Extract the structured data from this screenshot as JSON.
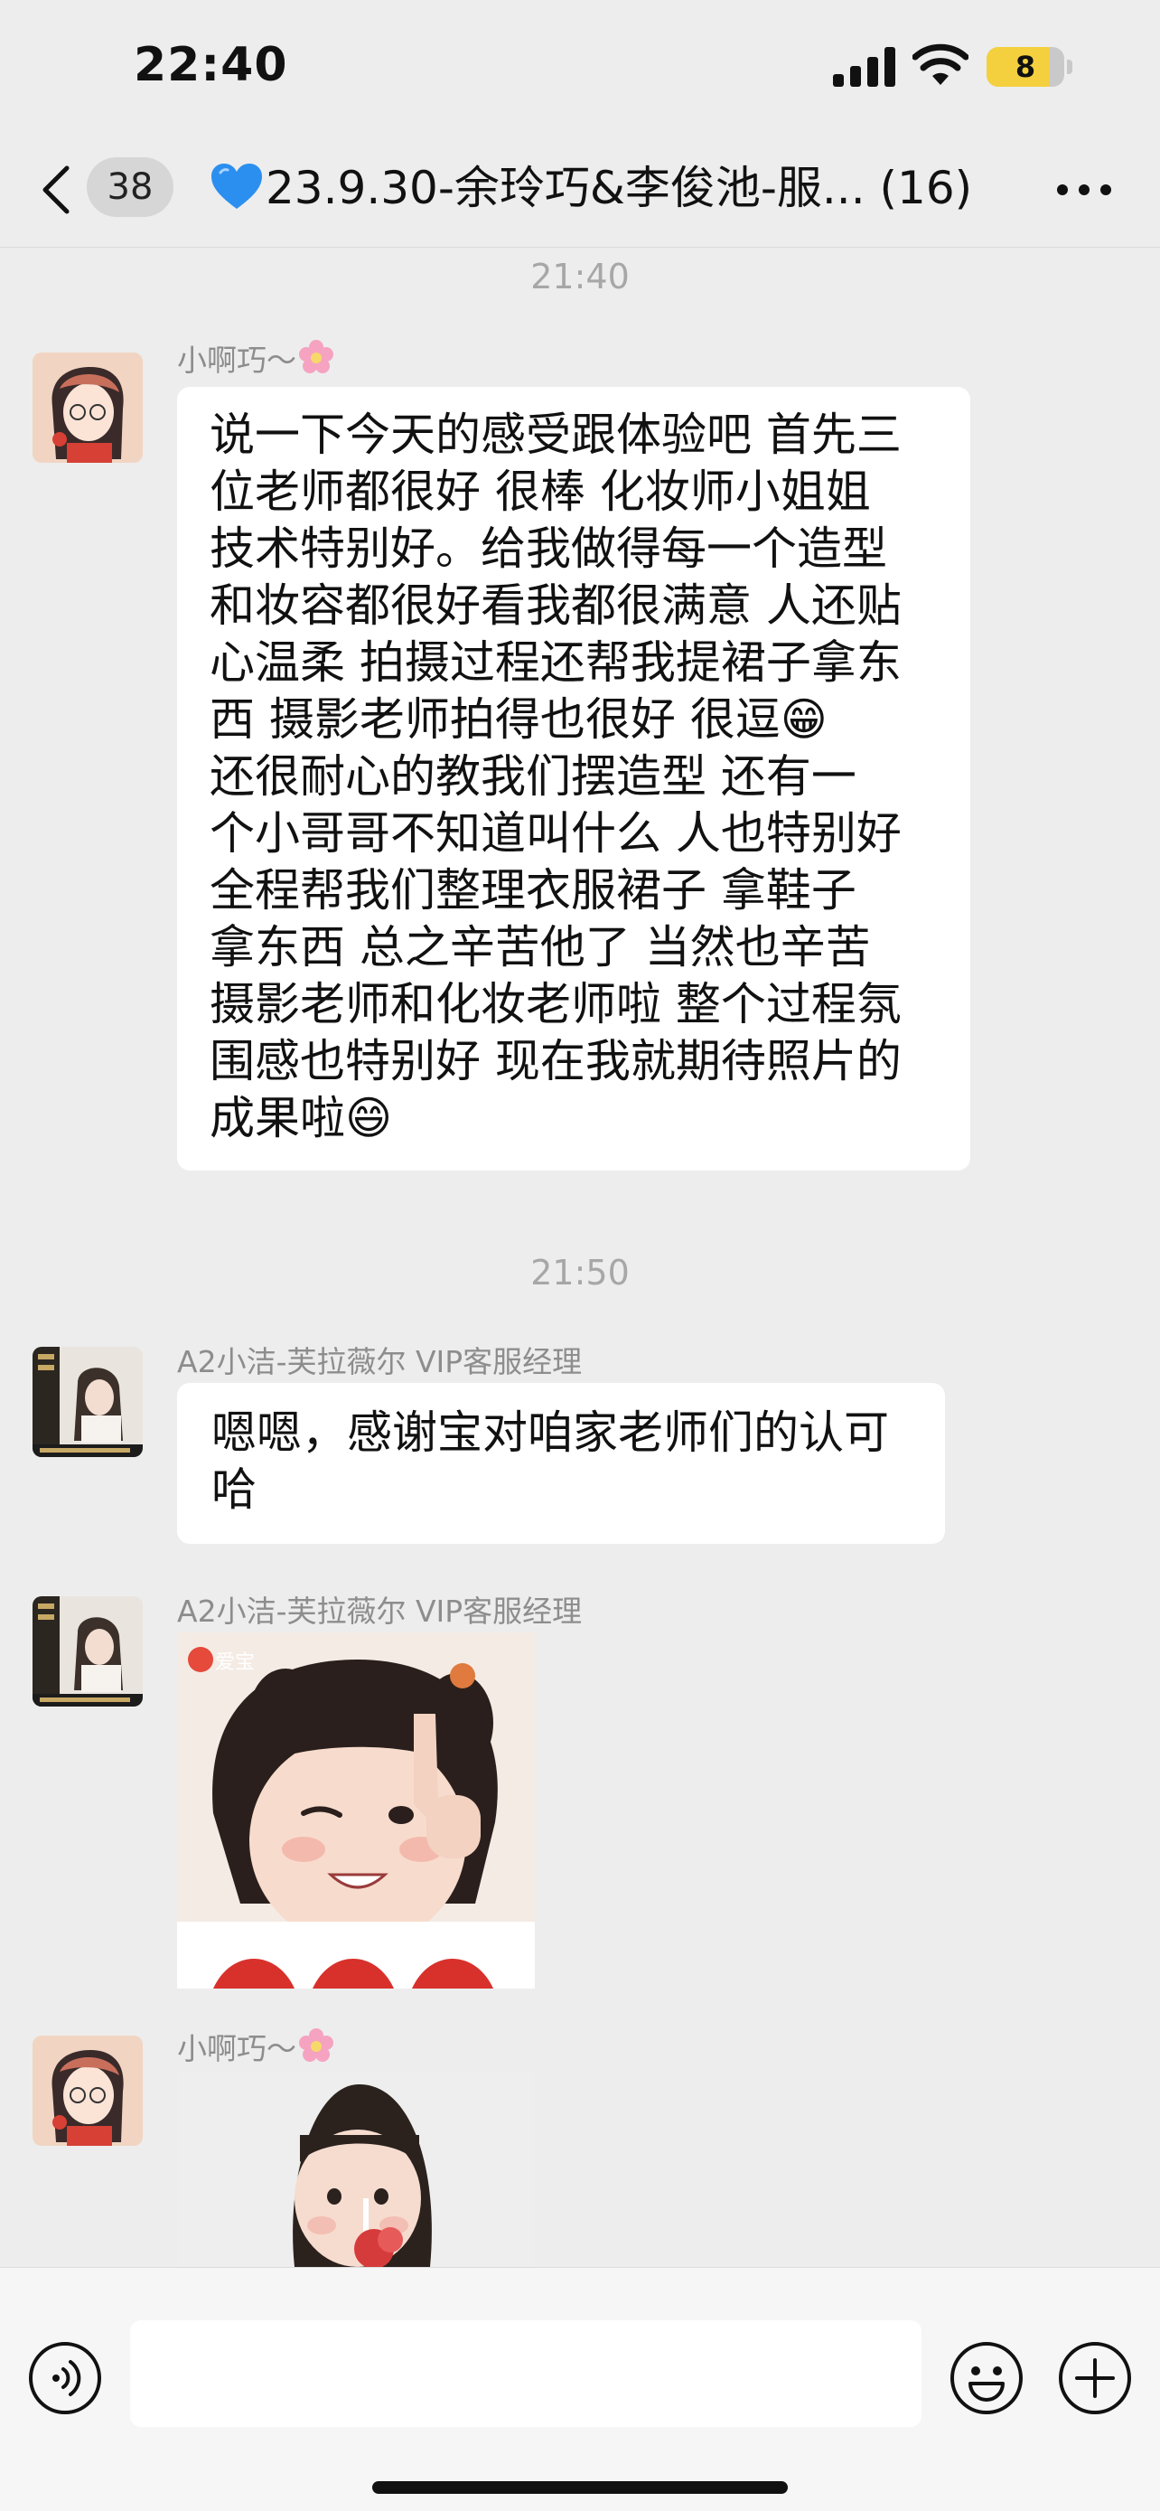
{
  "status_bar": {
    "time": "22:40",
    "battery_level": "8",
    "icons": [
      "signal-icon",
      "wifi-icon",
      "battery-icon"
    ]
  },
  "nav": {
    "unread_count": "38",
    "title": "23.9.30-余玲巧&李俊池-服...",
    "member_count": "(16)",
    "icons": [
      "back-icon",
      "blue-heart-icon",
      "more-icon"
    ]
  },
  "messages": [
    {
      "type": "timestamp",
      "text": "21:40"
    },
    {
      "type": "text",
      "sender": "小啊巧～",
      "lines": [
        "说一下今天的感受跟体验吧 首先三",
        "位老师都很好 很棒 化妆师小姐姐",
        "技术特别好。给我做得每一个造型",
        "和妆容都很好看我都很满意 人还贴",
        "心温柔 拍摄过程还帮我提裙子拿东",
        "西  摄影老师拍得也很好 很逗😁",
        "还很耐心的教我们摆造型  还有一",
        "个小哥哥不知道叫什么 人也特别好",
        " 全程帮我们整理衣服裙子 拿鞋子",
        "拿东西 总之辛苦他了 当然也辛苦",
        "摄影老师和化妆老师啦 整个过程氛",
        "围感也特别好 现在我就期待照片的",
        "成果啦😄"
      ]
    },
    {
      "type": "timestamp",
      "text": "21:50"
    },
    {
      "type": "text",
      "sender": "A2小洁-芙拉薇尔 VIP客服经理",
      "lines": [
        "嗯嗯，感谢宝对咱家老师们的认可",
        "哈"
      ]
    },
    {
      "type": "sticker",
      "sender": "A2小洁-芙拉薇尔 VIP客服经理",
      "watermark": "爱宝",
      "description": "sticker-toddler-wink"
    },
    {
      "type": "sticker",
      "sender": "小啊巧～",
      "description": "sticker-toddler-candy"
    }
  ],
  "input": {
    "value": "",
    "placeholder": "",
    "icons": [
      "voice-icon",
      "emoji-icon",
      "plus-icon"
    ]
  },
  "colors": {
    "background": "#ededed",
    "bubble": "#ffffff",
    "badge": "#d6d6d6",
    "battery_fill": "#f4d03f",
    "heart": "#2b8ff0"
  }
}
